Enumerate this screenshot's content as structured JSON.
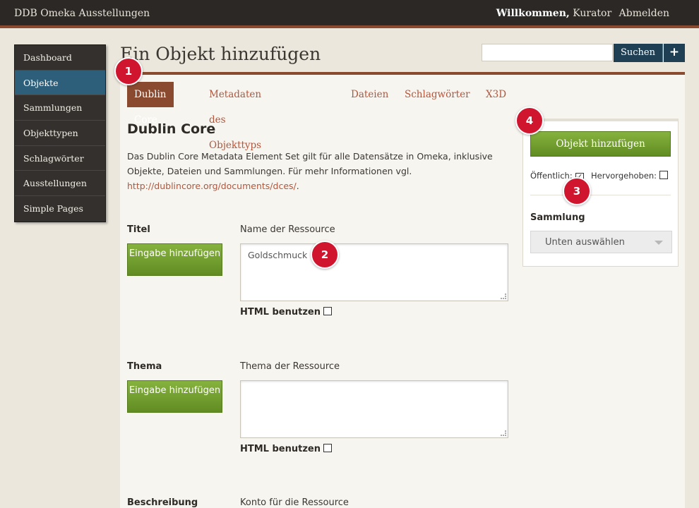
{
  "topbar": {
    "site_title": "DDB Omeka Ausstellungen",
    "welcome": "Willkommen,",
    "user": "Kurator",
    "logout": "Abmelden"
  },
  "sidebar": {
    "items": [
      {
        "label": "Dashboard"
      },
      {
        "label": "Objekte"
      },
      {
        "label": "Sammlungen"
      },
      {
        "label": "Objekttypen"
      },
      {
        "label": "Schlagwörter"
      },
      {
        "label": "Ausstellungen"
      },
      {
        "label": "Simple Pages"
      }
    ],
    "active": "Objekte"
  },
  "header": {
    "title": "Ein Objekt hinzufügen"
  },
  "search": {
    "placeholder": "",
    "button_label": "Suchen",
    "plus_label": "+"
  },
  "tabs": [
    {
      "label": "Dublin Core"
    },
    {
      "label": "Metadaten des Objekttyps"
    },
    {
      "label": "Dateien"
    },
    {
      "label": "Schlagwörter"
    },
    {
      "label": "X3D"
    }
  ],
  "section": {
    "title": "Dublin Core",
    "desc_part1": "Das Dublin Core Metadata Element Set gilt für alle Datensätze in Omeka, inklusive Objekte, Dateien und Sammlungen. Für mehr Informationen vgl.",
    "link_text": "http://dublincore.org/documents/dces/",
    "desc_part2": "."
  },
  "fields": [
    {
      "label": "Titel",
      "description": "Name der Ressource",
      "add_button": "Eingabe hinzufügen",
      "value": "Goldschmuck",
      "html_toggle": "HTML benutzen"
    },
    {
      "label": "Thema",
      "description": "Thema der Ressource",
      "add_button": "Eingabe hinzufügen",
      "value": "",
      "html_toggle": "HTML benutzen"
    },
    {
      "label": "Beschreibung",
      "description": "Konto für die Ressource"
    }
  ],
  "save_panel": {
    "submit_label": "Objekt hinzufügen",
    "public_label": "Öffentlich:",
    "public_checked": true,
    "featured_label": "Hervorgehoben:",
    "featured_checked": false,
    "collection_label": "Sammlung",
    "collection_select": "Unten auswählen"
  },
  "markers": [
    "1",
    "2",
    "3",
    "4"
  ],
  "colors": {
    "topbar": "#2b2826",
    "accent_brown": "#8a4a2f",
    "link": "#b2563c",
    "active_nav": "#2e5f7a",
    "search_button": "#1f3f54",
    "green_button": "#6f9b2c",
    "marker_red": "#d0152f"
  }
}
